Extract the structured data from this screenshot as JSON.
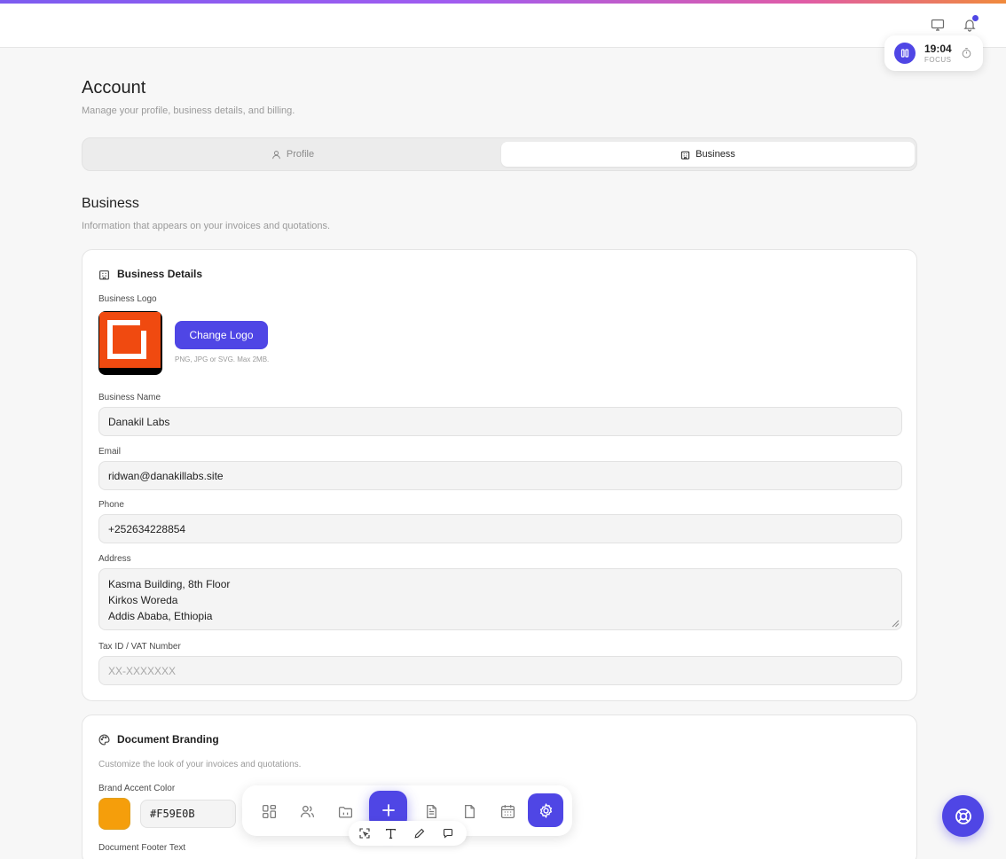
{
  "topbar": {
    "monitor_icon": "monitor-icon",
    "bell_icon": "bell-icon"
  },
  "focus": {
    "time": "19:04",
    "label": "FOCUS"
  },
  "header": {
    "title": "Account",
    "subtitle": "Manage your profile, business details, and billing."
  },
  "tabs": [
    {
      "label": "Profile",
      "icon": "user-icon",
      "active": false
    },
    {
      "label": "Business",
      "icon": "building-icon",
      "active": true
    }
  ],
  "section": {
    "title": "Business",
    "subtitle": "Information that appears on your invoices and quotations."
  },
  "business_details": {
    "title": "Business Details",
    "logo_label": "Business Logo",
    "change_logo_label": "Change Logo",
    "logo_hint": "PNG, JPG or SVG. Max 2MB.",
    "name_label": "Business Name",
    "name_value": "Danakil Labs",
    "email_label": "Email",
    "email_value": "ridwan@danakillabs.site",
    "phone_label": "Phone",
    "phone_value": "+252634228854",
    "address_label": "Address",
    "address_lines": [
      "Kasma Building, 8th Floor",
      "Kirkos Woreda",
      "Addis Ababa, Ethiopia"
    ],
    "tax_label": "Tax ID / VAT Number",
    "tax_placeholder": "XX-XXXXXXX"
  },
  "branding": {
    "title": "Document Branding",
    "subtitle": "Customize the look of your invoices and quotations.",
    "accent_label": "Brand Accent Color",
    "accent_value": "#F59E0B",
    "accent_color": "#F59E0B",
    "footer_label": "Document Footer Text"
  },
  "dock": {
    "items": [
      "dashboard-icon",
      "users-icon",
      "folder-icon",
      "plus-icon",
      "file-icon",
      "calculator-icon",
      "calendar-icon",
      "settings-icon"
    ]
  },
  "colors": {
    "accent": "#4f46e5"
  }
}
